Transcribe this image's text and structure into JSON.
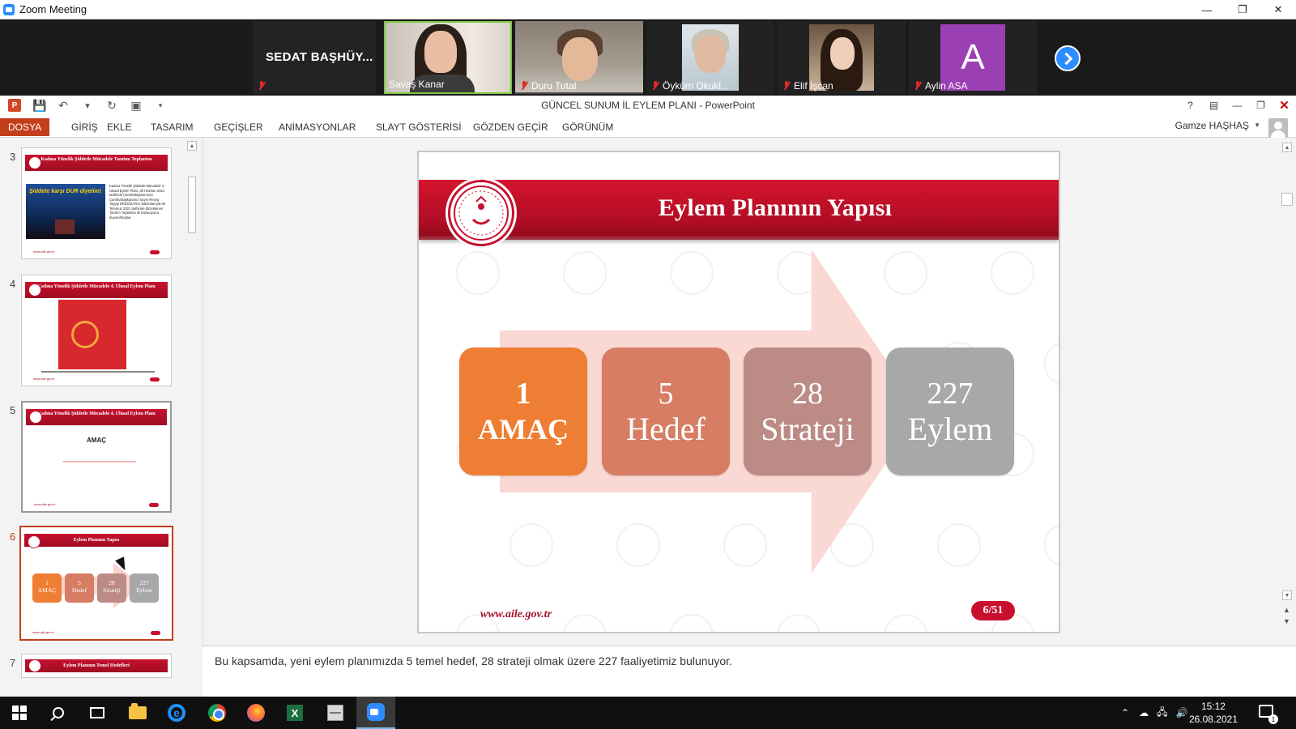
{
  "zoom": {
    "window_title": "Zoom Meeting",
    "participants": [
      {
        "name": "SEDAT  BAŞHÜY..."
      },
      {
        "name": "Savaş Kanar"
      },
      {
        "name": "Duru Tutal"
      },
      {
        "name": "Öyküm Okukl..."
      },
      {
        "name": "Elif İşcan"
      },
      {
        "name": "Aylin ASA",
        "avatar_letter": "A",
        "avatar_color": "#9b3fb4"
      }
    ]
  },
  "ppt": {
    "title": "GÜNCEL SUNUM İL EYLEM PLANI - PowerPoint",
    "logo_letter": "P",
    "help": "?",
    "ribbon_tabs": [
      "DOSYA",
      "GİRİŞ",
      "EKLE",
      "TASARIM",
      "GEÇİŞLER",
      "ANİMASYONLAR",
      "SLAYT GÖSTERİSİ",
      "GÖZDEN GEÇİR",
      "GÖRÜNÜM"
    ],
    "user_name": "Gamze HAŞHAŞ",
    "thumbnails": [
      {
        "number": "3",
        "title": "Kadına Yönelik Şiddetle Mücadele Tanıtım Toplantısı",
        "banner": "Şiddete karşı DUR diyelim!",
        "text": "Kadına Yönelik Şiddetle Mücadele 4. Ulusal Eylem Planı, 30 Haziran 2021 tarihinde (meslektaşlarımıza) Cumhurbaşkanımız Sayın Recep Tayyip ERDOĞAN'ın katılımlarıyla 05 Temmuz 2021 tarihinde düzenlenen Tanıtım Toplantısı ile kamuoyuna duyurulmuştur.",
        "footer": "www.aile.gov.tr"
      },
      {
        "number": "4",
        "title": "Kadına Yönelik Şiddetle Mücadele 4. Ulusal Eylem Planı",
        "footer": "www.aile.gov.tr"
      },
      {
        "number": "5",
        "title": "Kadına Yönelik Şiddetle Mücadele 4. Ulusal Eylem Planı",
        "heading": "AMAÇ",
        "footer": "www.aile.gov.tr"
      },
      {
        "number": "6",
        "title": "Eylem Planının Yapısı",
        "footer": "www.aile.gov.tr"
      },
      {
        "number": "7",
        "title": "Eylem Planının Temel Hedefleri"
      }
    ],
    "slide": {
      "title": "Eylem Planının Yapısı",
      "boxes": [
        {
          "num": "1",
          "label": "AMAÇ",
          "color": "#ee7e33"
        },
        {
          "num": "5",
          "label": "Hedef",
          "color": "#d67d63"
        },
        {
          "num": "28",
          "label": "Strateji",
          "color": "#bc8b86"
        },
        {
          "num": "227",
          "label": "Eylem",
          "color": "#a8a8a8"
        }
      ],
      "url": "www.aile.gov.tr",
      "page": "6/51"
    },
    "notes": "Bu kapsamda, yeni eylem planımızda 5 temel hedef, 28 strateji olmak üzere 227 faaliyetimiz bulunuyor."
  },
  "taskbar": {
    "excel_letter": "X",
    "ie_letter": "e",
    "time": "15:12",
    "date": "26.08.2021",
    "notification_count": "1"
  }
}
